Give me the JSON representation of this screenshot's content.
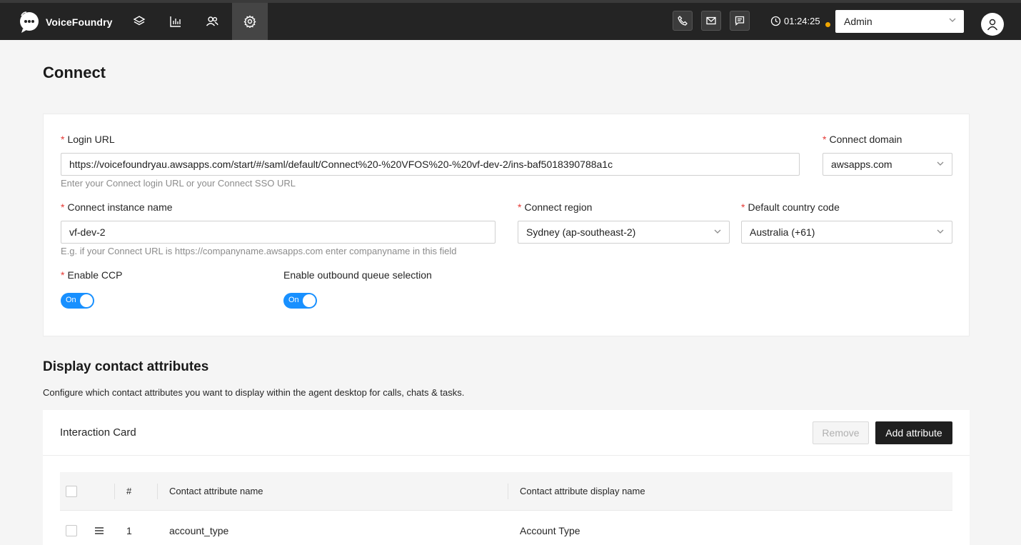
{
  "app": {
    "name": "VoiceFoundry"
  },
  "nav": [
    {
      "id": "layers",
      "icon": "layers-icon"
    },
    {
      "id": "reports",
      "icon": "bar-chart-icon"
    },
    {
      "id": "users",
      "icon": "users-icon"
    },
    {
      "id": "settings",
      "icon": "gear-icon",
      "active": true
    }
  ],
  "contact_buttons": [
    "phone-icon",
    "mail-icon",
    "chat-icon"
  ],
  "timer": "01:24:25",
  "status_color": "#f0a500",
  "role": "Admin",
  "page": {
    "title": "Connect"
  },
  "form": {
    "login_url": {
      "label": "Login URL",
      "value": "https://voicefoundryau.awsapps.com/start/#/saml/default/Connect%20-%20VFOS%20-%20vf-dev-2/ins-baf5018390788a1c",
      "help": "Enter your Connect login URL or your Connect SSO URL"
    },
    "connect_domain": {
      "label": "Connect domain",
      "value": "awsapps.com"
    },
    "instance_name": {
      "label": "Connect instance name",
      "value": "vf-dev-2",
      "help": "E.g. if your Connect URL is https://companyname.awsapps.com enter companyname in this field"
    },
    "region": {
      "label": "Connect region",
      "value": "Sydney (ap-southeast-2)"
    },
    "country_code": {
      "label": "Default country code",
      "value": "Australia (+61)"
    },
    "enable_ccp": {
      "label": "Enable CCP",
      "state": "On"
    },
    "outbound_queue": {
      "label": "Enable outbound queue selection",
      "state": "On"
    }
  },
  "attributes": {
    "title": "Display contact attributes",
    "description": "Configure which contact attributes you want to display within the agent desktop for calls, chats & tasks.",
    "card": {
      "title": "Interaction Card",
      "remove_label": "Remove",
      "add_label": "Add attribute"
    },
    "columns": {
      "num": "#",
      "name": "Contact attribute name",
      "display": "Contact attribute display name"
    },
    "rows": [
      {
        "num": "1",
        "name": "account_type",
        "display": "Account Type"
      }
    ]
  },
  "colors": {
    "accent": "#1890ff",
    "topbar": "#242424"
  }
}
